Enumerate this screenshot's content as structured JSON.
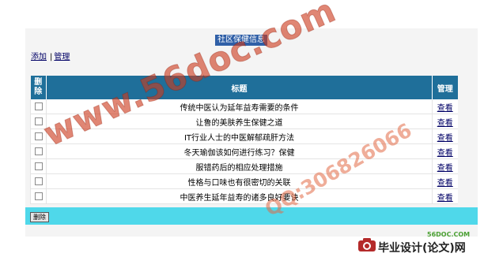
{
  "page": {
    "title": "社区保健信息"
  },
  "toolbar": {
    "add_label": "添加",
    "separator": "|",
    "manage_label": "管理"
  },
  "table": {
    "headers": {
      "delete_line1": "删",
      "delete_line2": "除",
      "title": "标题",
      "manage": "管理"
    },
    "rows": [
      {
        "title": "传统中医认为延年益寿需要的条件",
        "action": "查看"
      },
      {
        "title": "让鲁的美肤养生保健之道",
        "action": "查看"
      },
      {
        "title": "IT行业人士的中医解郁疏肝方法",
        "action": "查看"
      },
      {
        "title": "冬天瑜伽该如何进行练习？保健",
        "action": "查看"
      },
      {
        "title": "服错药后的相应处理措施",
        "action": "查看"
      },
      {
        "title": "性格与口味也有很密切的关联",
        "action": "查看"
      },
      {
        "title": "中医养生延年益寿的诸多良好要诀",
        "action": "查看"
      }
    ]
  },
  "footer": {
    "delete_button": "删除"
  },
  "watermark": {
    "main": "www.56doc.com",
    "qq": "QQ:306826066"
  },
  "brand": {
    "site": "56DOC.COM",
    "name": "毕业设计(论文)网",
    "icon": "camera-logo-icon"
  },
  "colors": {
    "header_bg": "#1f6f9a",
    "title_bg": "#2f5fa7",
    "footer_bar": "#4fd8ea",
    "link": "#000066",
    "watermark": "#cd3c1e",
    "brand_green": "#4aa032"
  }
}
